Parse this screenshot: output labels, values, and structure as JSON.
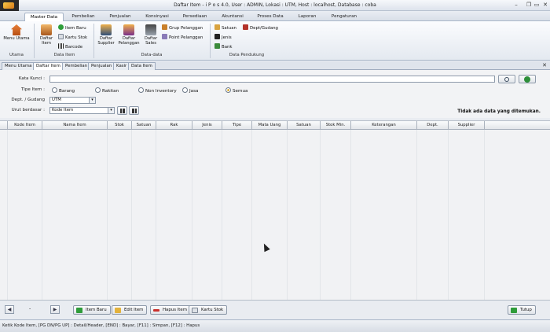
{
  "window": {
    "title": "Daftar Item - i P o s 4.0, User : ADMIN, Lokasi : UTM, Host : localhost, Database : coba",
    "controls": [
      "–",
      "❐",
      "▭",
      "✕"
    ]
  },
  "menu_tabs": [
    "Master Data",
    "Pembelian",
    "Penjualan",
    "Konsinyasi",
    "Persediaan",
    "Akuntansi",
    "Proses Data",
    "Laporan",
    "Pengaturan"
  ],
  "ribbon": {
    "groups": [
      "Utama",
      "Data Item",
      "Data-data",
      "Data Pendukung"
    ],
    "menu_utama": "Menu Utama",
    "daftar_item": "Daftar Item",
    "item_baru": "Item Baru",
    "kartu_stok": "Kartu Stok",
    "barcode": "Barcode",
    "daftar_supplier": "Daftar Supplier",
    "daftar_pelanggan": "Daftar Pelanggan",
    "daftar_sales": "Daftar Sales",
    "grup_pelanggan": "Grup Pelanggan",
    "point_pelanggan": "Point Pelanggan",
    "satuan": "Satuan",
    "dept_gudang": "Dept/Gudang",
    "jenis": "Jenis",
    "bank": "Bank"
  },
  "doc_tabs": [
    "Menu Utama",
    "Daftar Item",
    "Pembelian",
    "Penjualan",
    "Kasir",
    "Data Item"
  ],
  "form": {
    "kata_kunci_label": "Kata Kunci :",
    "kata_kunci_value": "",
    "tipe_item_label": "Tipe Item :",
    "tipe_options": [
      "Barang",
      "Rakitan",
      "Non Inventory",
      "Jasa",
      "Semua"
    ],
    "tipe_selected": "Semua",
    "dept_label": "Dept. / Gudang",
    "dept_value": "UTM",
    "urut_label": "Urut berdasar :",
    "urut_value": "Kode Item",
    "message": "Tidak ada data yang ditemukan."
  },
  "grid": {
    "columns": [
      "Kode Item",
      "Nama Item",
      "Stok",
      "Satuan",
      "Rak",
      "Jenis",
      "Tipe",
      "Mata Uang",
      "Satuan",
      "Stok Min.",
      "Keterangan",
      "Dept.",
      "Supplier"
    ]
  },
  "bottom": {
    "page_indicator": "-",
    "item_baru": "Item Baru",
    "edit_item": "Edit Item",
    "hapus_item": "Hapus Item",
    "kartu_stok": "Kartu Stok",
    "tutup": "Tutup"
  },
  "status": "Ketik Kode Item, [PG DN/PG UP] : Detail/Header, [END] : Bayar, [F11] : Simpan, [F12] : Hapus"
}
